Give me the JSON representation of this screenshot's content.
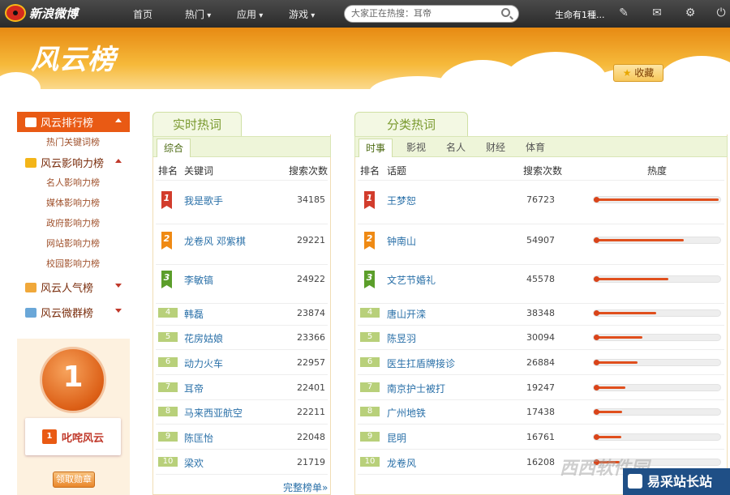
{
  "topbar": {
    "logo_text": "新浪微博",
    "nav": [
      {
        "label": "首页",
        "has_menu": false
      },
      {
        "label": "热门",
        "has_menu": true
      },
      {
        "label": "应用",
        "has_menu": true
      },
      {
        "label": "游戏",
        "has_menu": true
      }
    ],
    "search_placeholder": "大家正在热搜：耳帝",
    "user_name": "生命有1種...",
    "icons": [
      "edit-icon",
      "mail-icon",
      "gear-icon",
      "power-icon"
    ]
  },
  "banner": {
    "title": "风云榜",
    "favorite_label": "收藏"
  },
  "sidebar": {
    "groups": [
      {
        "label": "风云排行榜",
        "active": true,
        "expanded": true,
        "icon": "chart-icon",
        "items": [
          "热门关键词榜"
        ]
      },
      {
        "label": "风云影响力榜",
        "active": false,
        "expanded": true,
        "icon": "crown-icon",
        "items": [
          "名人影响力榜",
          "媒体影响力榜",
          "政府影响力榜",
          "网站影响力榜",
          "校园影响力榜"
        ]
      },
      {
        "label": "风云人气榜",
        "active": false,
        "expanded": false,
        "icon": "people-icon",
        "items": []
      },
      {
        "label": "风云微群榜",
        "active": false,
        "expanded": false,
        "icon": "group-icon",
        "items": []
      }
    ],
    "promo": {
      "medal_text": "1",
      "title": "叱咤风云",
      "button": "领取勋章"
    }
  },
  "realtime": {
    "title": "实时热词",
    "tab": "综合",
    "headers": {
      "rank": "排名",
      "keyword": "关键词",
      "count": "搜索次数"
    },
    "rows": [
      {
        "rank": "1",
        "keyword": "我是歌手",
        "count": "34185"
      },
      {
        "rank": "2",
        "keyword": "龙卷风 邓紫棋",
        "count": "29221"
      },
      {
        "rank": "3",
        "keyword": "李敏镐",
        "count": "24922"
      },
      {
        "rank": "4",
        "keyword": "韩磊",
        "count": "23874"
      },
      {
        "rank": "5",
        "keyword": "花房姑娘",
        "count": "23366"
      },
      {
        "rank": "6",
        "keyword": "动力火车",
        "count": "22957"
      },
      {
        "rank": "7",
        "keyword": "耳帝",
        "count": "22401"
      },
      {
        "rank": "8",
        "keyword": "马来西亚航空",
        "count": "22211"
      },
      {
        "rank": "9",
        "keyword": "陈匡怡",
        "count": "22048"
      },
      {
        "rank": "10",
        "keyword": "梁欢",
        "count": "21719"
      }
    ],
    "more_label": "完整榜单»"
  },
  "category": {
    "title": "分类热词",
    "tabs": [
      "时事",
      "影视",
      "名人",
      "财经",
      "体育"
    ],
    "active_tab": "时事",
    "headers": {
      "rank": "排名",
      "topic": "话题",
      "count": "搜索次数",
      "heat": "热度"
    },
    "rows": [
      {
        "rank": "1",
        "topic": "王梦恕",
        "count": "76723",
        "heat": 1.0
      },
      {
        "rank": "2",
        "topic": "钟南山",
        "count": "54907",
        "heat": 0.72
      },
      {
        "rank": "3",
        "topic": "文艺节婚礼",
        "count": "45578",
        "heat": 0.6
      },
      {
        "rank": "4",
        "topic": "唐山开滦",
        "count": "38348",
        "heat": 0.5
      },
      {
        "rank": "5",
        "topic": "陈昱羽",
        "count": "30094",
        "heat": 0.39
      },
      {
        "rank": "6",
        "topic": "医生扛盾牌接诊",
        "count": "26884",
        "heat": 0.35
      },
      {
        "rank": "7",
        "topic": "南京护士被打",
        "count": "19247",
        "heat": 0.25
      },
      {
        "rank": "8",
        "topic": "广州地铁",
        "count": "17438",
        "heat": 0.23
      },
      {
        "rank": "9",
        "topic": "昆明",
        "count": "16761",
        "heat": 0.22
      },
      {
        "rank": "10",
        "topic": "龙卷风",
        "count": "16208",
        "heat": 0.21
      }
    ]
  },
  "watermark": {
    "text": "易采站长站",
    "ghost": "西西软件园"
  }
}
